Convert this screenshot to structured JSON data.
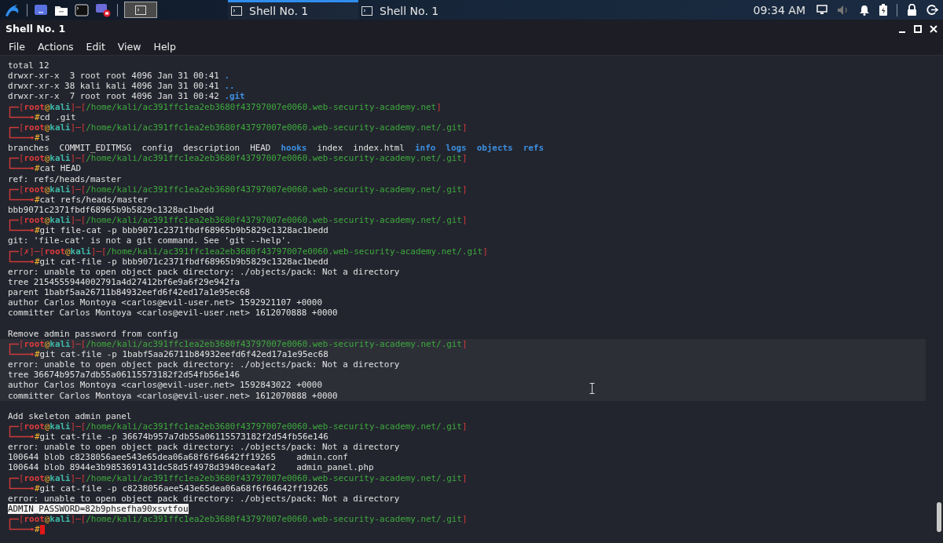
{
  "taskbar": {
    "tasks": [
      {
        "title": "Shell No. 1",
        "selected": true
      },
      {
        "title": "Shell No. 1",
        "selected": false
      }
    ],
    "clock": "09:34 AM"
  },
  "window": {
    "title": "Shell No. 1",
    "menu": [
      "File",
      "Actions",
      "Edit",
      "View",
      "Help"
    ]
  },
  "terminal": {
    "blocks": [
      {
        "highlighted": false,
        "lines": [
          {
            "kind": "output",
            "text": "total 12"
          },
          {
            "kind": "listing",
            "text": "drwxr-xr-x  3 root root 4096 Jan 31 00:41 ",
            "name": "."
          },
          {
            "kind": "listing",
            "text": "drwxr-xr-x 38 kali kali 4096 Jan 31 00:41 ",
            "name": ".."
          },
          {
            "kind": "listing",
            "text": "drwxr-xr-x  7 root root 4096 Jan 31 00:42 ",
            "name": ".git"
          },
          {
            "kind": "prompt",
            "segments": [
              {
                "kind": "frame",
                "text": "["
              },
              {
                "kind": "user",
                "text": "root"
              },
              {
                "kind": "at",
                "text": "@"
              },
              {
                "kind": "host",
                "text": "kali"
              },
              {
                "kind": "frame",
                "text": "]─["
              },
              {
                "kind": "path",
                "text": "/home/kali/ac391ffc1ea2eb3680f43797007e0060.web-security-academy.net"
              },
              {
                "kind": "frame",
                "text": "]"
              }
            ]
          },
          {
            "kind": "command",
            "symbol": "#",
            "text": "cd .git"
          },
          {
            "kind": "prompt",
            "segments": [
              {
                "kind": "frame",
                "text": "["
              },
              {
                "kind": "user",
                "text": "root"
              },
              {
                "kind": "at",
                "text": "@"
              },
              {
                "kind": "host",
                "text": "kali"
              },
              {
                "kind": "frame",
                "text": "]─["
              },
              {
                "kind": "path",
                "text": "/home/kali/ac391ffc1ea2eb3680f43797007e0060.web-security-academy.net/.git"
              },
              {
                "kind": "frame",
                "text": "]"
              }
            ]
          },
          {
            "kind": "command",
            "symbol": "#",
            "text": "ls"
          },
          {
            "kind": "ls",
            "items": [
              {
                "name": "branches",
                "dir": false
              },
              {
                "name": "COMMIT_EDITMSG",
                "dir": false
              },
              {
                "name": "config",
                "dir": false
              },
              {
                "name": "description",
                "dir": false
              },
              {
                "name": "HEAD",
                "dir": false
              },
              {
                "name": "hooks",
                "dir": true
              },
              {
                "name": "index",
                "dir": false
              },
              {
                "name": "index.html",
                "dir": false
              },
              {
                "name": "info",
                "dir": true
              },
              {
                "name": "logs",
                "dir": true
              },
              {
                "name": "objects",
                "dir": true
              },
              {
                "name": "refs",
                "dir": true
              }
            ]
          },
          {
            "kind": "prompt",
            "segments": [
              {
                "kind": "frame",
                "text": "["
              },
              {
                "kind": "user",
                "text": "root"
              },
              {
                "kind": "at",
                "text": "@"
              },
              {
                "kind": "host",
                "text": "kali"
              },
              {
                "kind": "frame",
                "text": "]─["
              },
              {
                "kind": "path",
                "text": "/home/kali/ac391ffc1ea2eb3680f43797007e0060.web-security-academy.net/.git"
              },
              {
                "kind": "frame",
                "text": "]"
              }
            ]
          },
          {
            "kind": "command",
            "symbol": "#",
            "text": "cat HEAD"
          },
          {
            "kind": "output",
            "text": "ref: refs/heads/master"
          },
          {
            "kind": "prompt",
            "segments": [
              {
                "kind": "frame",
                "text": "["
              },
              {
                "kind": "user",
                "text": "root"
              },
              {
                "kind": "at",
                "text": "@"
              },
              {
                "kind": "host",
                "text": "kali"
              },
              {
                "kind": "frame",
                "text": "]─["
              },
              {
                "kind": "path",
                "text": "/home/kali/ac391ffc1ea2eb3680f43797007e0060.web-security-academy.net/.git"
              },
              {
                "kind": "frame",
                "text": "]"
              }
            ]
          },
          {
            "kind": "command",
            "symbol": "#",
            "text": "cat refs/heads/master"
          },
          {
            "kind": "output",
            "text": "bbb9071c2371fbdf68965b9b5829c1328ac1bedd"
          },
          {
            "kind": "prompt",
            "segments": [
              {
                "kind": "frame",
                "text": "["
              },
              {
                "kind": "user",
                "text": "root"
              },
              {
                "kind": "at",
                "text": "@"
              },
              {
                "kind": "host",
                "text": "kali"
              },
              {
                "kind": "frame",
                "text": "]─["
              },
              {
                "kind": "path",
                "text": "/home/kali/ac391ffc1ea2eb3680f43797007e0060.web-security-academy.net/.git"
              },
              {
                "kind": "frame",
                "text": "]"
              }
            ]
          },
          {
            "kind": "command",
            "symbol": "#",
            "text": "git file-cat -p bbb9071c2371fbdf68965b9b5829c1328ac1bedd"
          },
          {
            "kind": "output",
            "text": "git: 'file-cat' is not a git command. See 'git --help'."
          },
          {
            "kind": "prompt",
            "segments": [
              {
                "kind": "frame",
                "text": "["
              },
              {
                "kind": "fail",
                "text": "✗"
              },
              {
                "kind": "frame",
                "text": "]─["
              },
              {
                "kind": "user",
                "text": "root"
              },
              {
                "kind": "at",
                "text": "@"
              },
              {
                "kind": "host",
                "text": "kali"
              },
              {
                "kind": "frame",
                "text": "]─["
              },
              {
                "kind": "path",
                "text": "/home/kali/ac391ffc1ea2eb3680f43797007e0060.web-security-academy.net/.git"
              },
              {
                "kind": "frame",
                "text": "]"
              }
            ]
          },
          {
            "kind": "command",
            "symbol": "#",
            "text": "git cat-file -p bbb9071c2371fbdf68965b9b5829c1328ac1bedd"
          },
          {
            "kind": "output",
            "text": "error: unable to open object pack directory: ./objects/pack: Not a directory"
          },
          {
            "kind": "output",
            "text": "tree 2154555944002791a4d27412bf6e9a6f29e942fa"
          },
          {
            "kind": "output",
            "text": "parent 1babf5aa26711b84932eefd6f42ed17a1e95ec68"
          },
          {
            "kind": "output",
            "text": "author Carlos Montoya <carlos@evil-user.net> 1592921107 +0000"
          },
          {
            "kind": "output",
            "text": "committer Carlos Montoya <carlos@evil-user.net> 1612070888 +0000"
          },
          {
            "kind": "blank"
          },
          {
            "kind": "output",
            "text": "Remove admin password from config"
          }
        ]
      },
      {
        "highlighted": true,
        "lines": [
          {
            "kind": "prompt",
            "segments": [
              {
                "kind": "frame",
                "text": "["
              },
              {
                "kind": "user",
                "text": "root"
              },
              {
                "kind": "at",
                "text": "@"
              },
              {
                "kind": "host",
                "text": "kali"
              },
              {
                "kind": "frame",
                "text": "]─["
              },
              {
                "kind": "path",
                "text": "/home/kali/ac391ffc1ea2eb3680f43797007e0060.web-security-academy.net/.git"
              },
              {
                "kind": "frame",
                "text": "]"
              }
            ]
          },
          {
            "kind": "command",
            "symbol": "#",
            "text": "git cat-file -p 1babf5aa26711b84932eefd6f42ed17a1e95ec68"
          },
          {
            "kind": "output",
            "text": "error: unable to open object pack directory: ./objects/pack: Not a directory"
          },
          {
            "kind": "output",
            "text": "tree 36674b957a7db55a06115573182f2d54fb56e146"
          },
          {
            "kind": "output",
            "text": "author Carlos Montoya <carlos@evil-user.net> 1592843022 +0000"
          },
          {
            "kind": "output",
            "text": "committer Carlos Montoya <carlos@evil-user.net> 1612070888 +0000"
          }
        ]
      },
      {
        "highlighted": false,
        "lines": [
          {
            "kind": "blank"
          },
          {
            "kind": "output",
            "text": "Add skeleton admin panel"
          },
          {
            "kind": "prompt",
            "segments": [
              {
                "kind": "frame",
                "text": "["
              },
              {
                "kind": "user",
                "text": "root"
              },
              {
                "kind": "at",
                "text": "@"
              },
              {
                "kind": "host",
                "text": "kali"
              },
              {
                "kind": "frame",
                "text": "]─["
              },
              {
                "kind": "path",
                "text": "/home/kali/ac391ffc1ea2eb3680f43797007e0060.web-security-academy.net/.git"
              },
              {
                "kind": "frame",
                "text": "]"
              }
            ]
          },
          {
            "kind": "command",
            "symbol": "#",
            "text": "git cat-file -p 36674b957a7db55a06115573182f2d54fb56e146"
          },
          {
            "kind": "output",
            "text": "error: unable to open object pack directory: ./objects/pack: Not a directory"
          },
          {
            "kind": "output",
            "text": "100644 blob c8238056aee543e65dea06a68f6f64642ff19265    admin.conf"
          },
          {
            "kind": "output",
            "text": "100644 blob 8944e3b9853691431dc58d5f4978d3940cea4af2    admin_panel.php"
          },
          {
            "kind": "prompt",
            "segments": [
              {
                "kind": "frame",
                "text": "["
              },
              {
                "kind": "user",
                "text": "root"
              },
              {
                "kind": "at",
                "text": "@"
              },
              {
                "kind": "host",
                "text": "kali"
              },
              {
                "kind": "frame",
                "text": "]─["
              },
              {
                "kind": "path",
                "text": "/home/kali/ac391ffc1ea2eb3680f43797007e0060.web-security-academy.net/.git"
              },
              {
                "kind": "frame",
                "text": "]"
              }
            ]
          },
          {
            "kind": "command",
            "symbol": "#",
            "text": "git cat-file -p c8238056aee543e65dea06a68f6f64642ff19265"
          },
          {
            "kind": "output",
            "text": "error: unable to open object pack directory: ./objects/pack: Not a directory"
          },
          {
            "kind": "selection",
            "text": "ADMIN_PASSWORD=82b9phsefha90xsvtfou"
          },
          {
            "kind": "prompt",
            "segments": [
              {
                "kind": "frame",
                "text": "["
              },
              {
                "kind": "user",
                "text": "root"
              },
              {
                "kind": "at",
                "text": "@"
              },
              {
                "kind": "host",
                "text": "kali"
              },
              {
                "kind": "frame",
                "text": "]─["
              },
              {
                "kind": "path",
                "text": "/home/kali/ac391ffc1ea2eb3680f43797007e0060.web-security-academy.net/.git"
              },
              {
                "kind": "frame",
                "text": "]"
              }
            ]
          },
          {
            "kind": "command",
            "symbol": "#",
            "cursor": true
          }
        ]
      }
    ]
  }
}
